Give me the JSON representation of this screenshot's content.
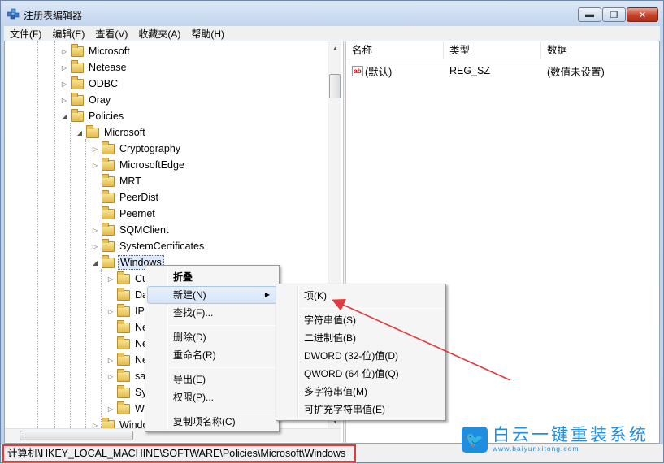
{
  "window": {
    "title": "注册表编辑器",
    "controls": {
      "minimize": "▬",
      "maximize": "❐",
      "close": "✕"
    }
  },
  "menubar": [
    "文件(F)",
    "编辑(E)",
    "查看(V)",
    "收藏夹(A)",
    "帮助(H)"
  ],
  "tree": [
    {
      "label": "Microsoft",
      "expander": "▷"
    },
    {
      "label": "Netease",
      "expander": "▷"
    },
    {
      "label": "ODBC",
      "expander": "▷"
    },
    {
      "label": "Oray",
      "expander": "▷"
    },
    {
      "label": "Policies",
      "expander": "◢"
    },
    {
      "label": "Microsoft",
      "expander": "◢"
    },
    {
      "label": "Cryptography",
      "expander": "▷"
    },
    {
      "label": "MicrosoftEdge",
      "expander": "▷"
    },
    {
      "label": "MRT",
      "expander": ""
    },
    {
      "label": "PeerDist",
      "expander": ""
    },
    {
      "label": "Peernet",
      "expander": ""
    },
    {
      "label": "SQMClient",
      "expander": "▷"
    },
    {
      "label": "SystemCertificates",
      "expander": "▷"
    },
    {
      "label": "Windows",
      "expander": "◢"
    },
    {
      "label": "Cu",
      "expander": "▷"
    },
    {
      "label": "Da",
      "expander": ""
    },
    {
      "label": "IP",
      "expander": "▷"
    },
    {
      "label": "Ne",
      "expander": ""
    },
    {
      "label": "Ne",
      "expander": ""
    },
    {
      "label": "Ne",
      "expander": "▷"
    },
    {
      "label": "sa",
      "expander": "▷"
    },
    {
      "label": "Sy",
      "expander": ""
    },
    {
      "label": "W",
      "expander": "▷"
    },
    {
      "label": "Windo",
      "expander": "▷"
    }
  ],
  "list": {
    "columns": [
      "名称",
      "类型",
      "数据"
    ],
    "rows": [
      {
        "name": "(默认)",
        "type": "REG_SZ",
        "data": "(数值未设置)",
        "icon": "ab"
      }
    ]
  },
  "context_menu": {
    "items": [
      "折叠",
      "新建(N)",
      "查找(F)...",
      "删除(D)",
      "重命名(R)",
      "导出(E)",
      "权限(P)...",
      "复制项名称(C)"
    ],
    "submenu_arrow": "▶"
  },
  "submenu": {
    "items": [
      "项(K)",
      "字符串值(S)",
      "二进制值(B)",
      "DWORD (32-位)值(D)",
      "QWORD (64 位)值(Q)",
      "多字符串值(M)",
      "可扩充字符串值(E)"
    ]
  },
  "statusbar": {
    "path": "计算机\\HKEY_LOCAL_MACHINE\\SOFTWARE\\Policies\\Microsoft\\Windows"
  },
  "watermark": {
    "title": "白云一键重装系统",
    "url": "www.baiyunxitong.com",
    "logo_glyph": "🐦"
  },
  "colors": {
    "annotation": "#e0393e",
    "selection": "#ddeafb",
    "watermark": "#1f8de0"
  }
}
